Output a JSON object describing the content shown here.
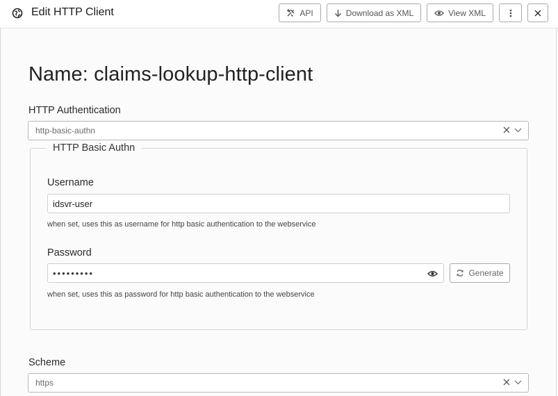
{
  "header": {
    "title": "Edit HTTP Client",
    "buttons": {
      "api": "API",
      "download": "Download as XML",
      "view": "View XML"
    }
  },
  "main": {
    "name_title": "Name: claims-lookup-http-client",
    "http_auth": {
      "label": "HTTP Authentication",
      "value": "http-basic-authn"
    },
    "basic_authn": {
      "legend": "HTTP Basic Authn",
      "username": {
        "label": "Username",
        "value": "idsvr-user",
        "help": "when set, uses this as username for http basic authentication to the webservice"
      },
      "password": {
        "label": "Password",
        "value": "•••••••••",
        "help": "when set, uses this as password for http basic authentication to the webservice",
        "generate_label": "Generate"
      }
    },
    "scheme": {
      "label": "Scheme",
      "value": "https"
    }
  },
  "icons": [
    "globe-icon",
    "tools-icon",
    "download-arrow-icon",
    "eye-icon",
    "more-vertical-icon",
    "close-icon",
    "clear-x-icon",
    "chevron-down-icon",
    "refresh-icon"
  ]
}
